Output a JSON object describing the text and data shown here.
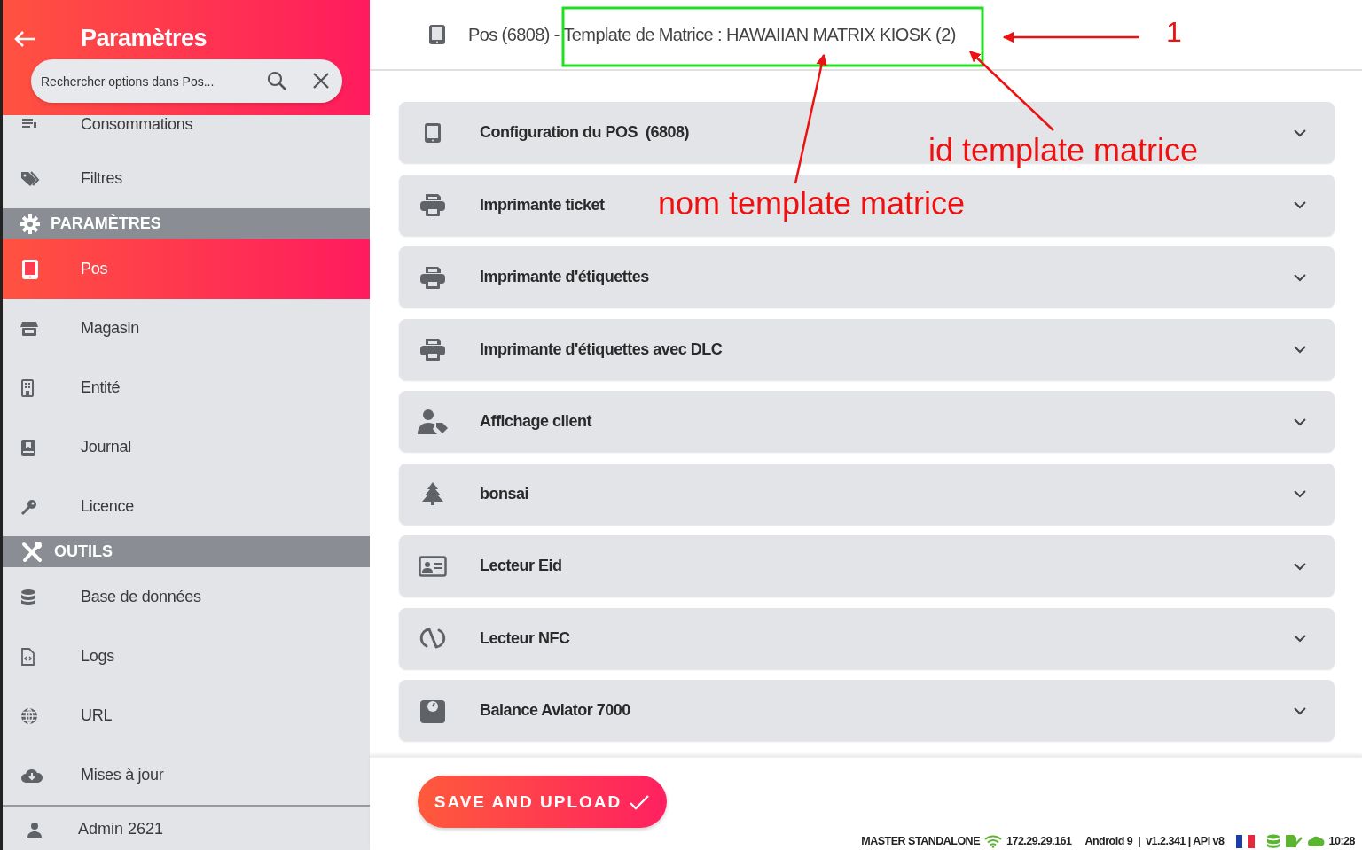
{
  "sidebar": {
    "title": "Paramètres",
    "search": {
      "placeholder": "Rechercher options dans Pos..."
    },
    "entries": [
      {
        "kind": "item",
        "label": "Consommations",
        "selected": false
      },
      {
        "kind": "item",
        "label": "Filtres",
        "selected": false
      },
      {
        "kind": "section",
        "label": "PARAMÈTRES"
      },
      {
        "kind": "item",
        "label": "Pos",
        "selected": true
      },
      {
        "kind": "item",
        "label": "Magasin",
        "selected": false
      },
      {
        "kind": "item",
        "label": "Entité",
        "selected": false
      },
      {
        "kind": "item",
        "label": "Journal",
        "selected": false
      },
      {
        "kind": "item",
        "label": "Licence",
        "selected": false
      },
      {
        "kind": "section",
        "label": "OUTILS"
      },
      {
        "kind": "item",
        "label": "Base de données",
        "selected": false
      },
      {
        "kind": "item",
        "label": "Logs",
        "selected": false
      },
      {
        "kind": "item",
        "label": "URL",
        "selected": false
      },
      {
        "kind": "item",
        "label": "Mises à jour",
        "selected": false
      }
    ],
    "user": "Admin 2621"
  },
  "header": {
    "title": "Pos (6808) - Template de Matrice : HAWAIIAN MATRIX KIOSK (2)"
  },
  "panels": [
    {
      "label": "Configuration du POS  (6808)",
      "expanded": false
    },
    {
      "label": "Imprimante ticket",
      "expanded": false
    },
    {
      "label": "Imprimante d'étiquettes",
      "expanded": false
    },
    {
      "label": "Imprimante d'étiquettes avec DLC",
      "expanded": false
    },
    {
      "label": "Affichage client",
      "expanded": false
    },
    {
      "label": "bonsai",
      "expanded": false
    },
    {
      "label": "Lecteur Eid",
      "expanded": false
    },
    {
      "label": "Lecteur NFC",
      "expanded": false
    },
    {
      "label": "Balance Aviator 7000",
      "expanded": false
    }
  ],
  "save_button": "SAVE AND UPLOAD",
  "status_bar": {
    "mode": "MASTER STANDALONE",
    "ip": "172.29.29.161",
    "version": "Android 9  |  v1.2.341 | API v8",
    "time": "10:28"
  },
  "annotations": [
    {
      "kind": "number",
      "text": "1"
    },
    {
      "kind": "note",
      "text": "id template matrice"
    },
    {
      "kind": "note",
      "text": "nom template matrice"
    }
  ]
}
